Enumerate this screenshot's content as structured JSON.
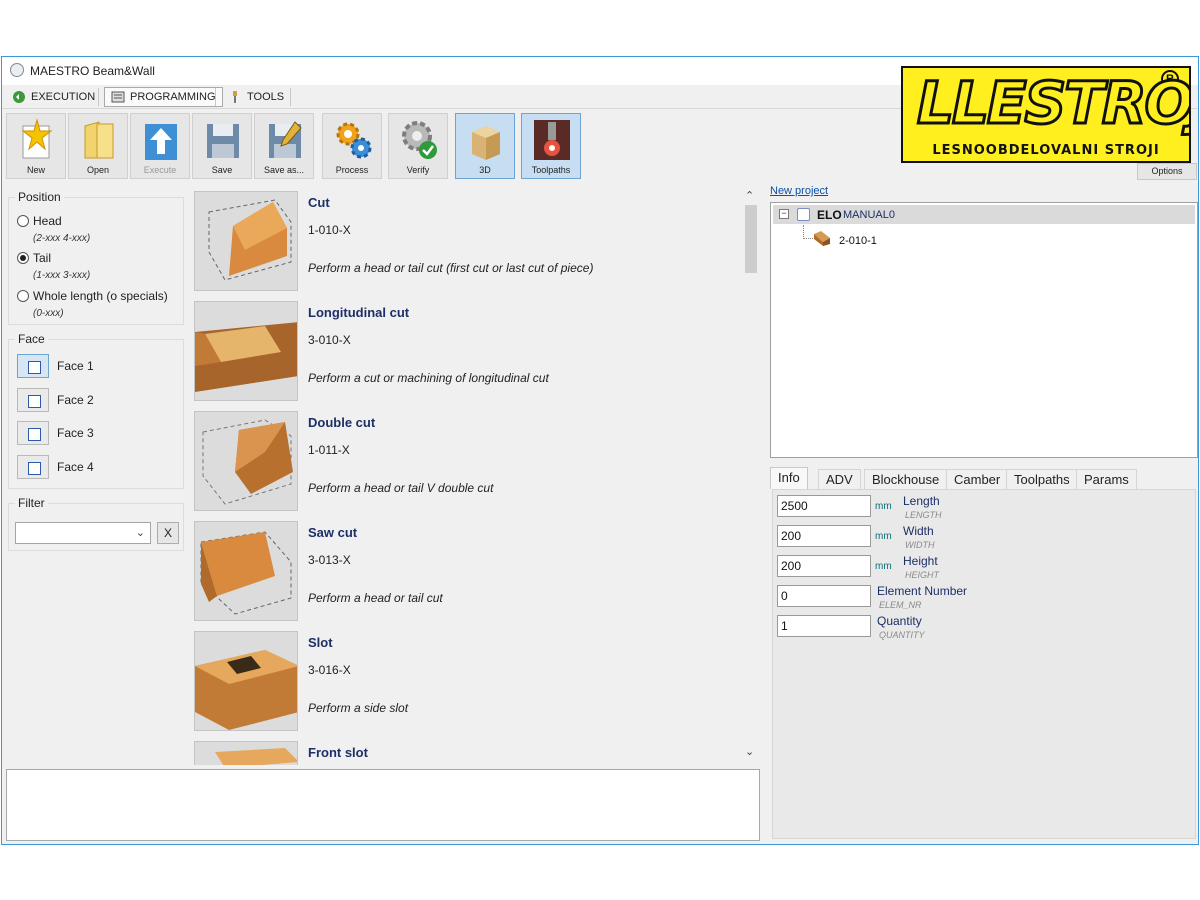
{
  "window": {
    "title": "MAESTRO Beam&Wall"
  },
  "modes": [
    {
      "label": "EXECUTION"
    },
    {
      "label": "PROGRAMMING"
    },
    {
      "label": "TOOLS"
    }
  ],
  "toolbar": {
    "new": "New",
    "open": "Open",
    "execute": "Execute",
    "save": "Save",
    "save_as": "Save as...",
    "process": "Process",
    "verify": "Verify",
    "view3d": "3D",
    "toolpaths": "Toolpaths",
    "options": "Options"
  },
  "logo": {
    "main": "LLESTROJ",
    "sub": "LESNOOBDELOVALNI STROJI",
    "reg": "R"
  },
  "position": {
    "title": "Position",
    "options": [
      {
        "label": "Head",
        "hint": "(2-xxx 4-xxx)"
      },
      {
        "label": "Tail",
        "hint": "(1-xxx 3-xxx)"
      },
      {
        "label": "Whole length (o specials)",
        "hint": "(0-xxx)"
      }
    ],
    "selected": "Tail"
  },
  "face": {
    "title": "Face",
    "items": [
      "Face 1",
      "Face 2",
      "Face 3",
      "Face 4"
    ]
  },
  "filter": {
    "title": "Filter",
    "value": "",
    "clear": "X"
  },
  "macros": [
    {
      "name": "Cut",
      "code": "1-010-X",
      "desc": "Perform a head or tail cut (first cut or last cut of piece)"
    },
    {
      "name": "Longitudinal cut",
      "code": "3-010-X",
      "desc": "Perform a cut or machining of longitudinal cut"
    },
    {
      "name": "Double cut",
      "code": "1-011-X",
      "desc": "Perform a head or tail V double cut"
    },
    {
      "name": "Saw cut",
      "code": "3-013-X",
      "desc": "Perform a head or tail cut"
    },
    {
      "name": "Slot",
      "code": "3-016-X",
      "desc": "Perform a side slot"
    },
    {
      "name": "Front slot",
      "code": "",
      "desc": ""
    }
  ],
  "project": {
    "new_link": "New project",
    "root_code": "ELO",
    "root_name": "MANUAL0",
    "child": "2-010-1"
  },
  "tabs": [
    "Info",
    "ADV",
    "Blockhouse",
    "Camber",
    "Toolpaths",
    "Params"
  ],
  "info": [
    {
      "value": "2500",
      "unit": "mm",
      "label": "Length",
      "sub": "LENGTH"
    },
    {
      "value": "200",
      "unit": "mm",
      "label": "Width",
      "sub": "WIDTH"
    },
    {
      "value": "200",
      "unit": "mm",
      "label": "Height",
      "sub": "HEIGHT"
    },
    {
      "value": "0",
      "unit": "",
      "label": "Element Number",
      "sub": "ELEM_NR"
    },
    {
      "value": "1",
      "unit": "",
      "label": "Quantity",
      "sub": "QUANTITY"
    }
  ]
}
